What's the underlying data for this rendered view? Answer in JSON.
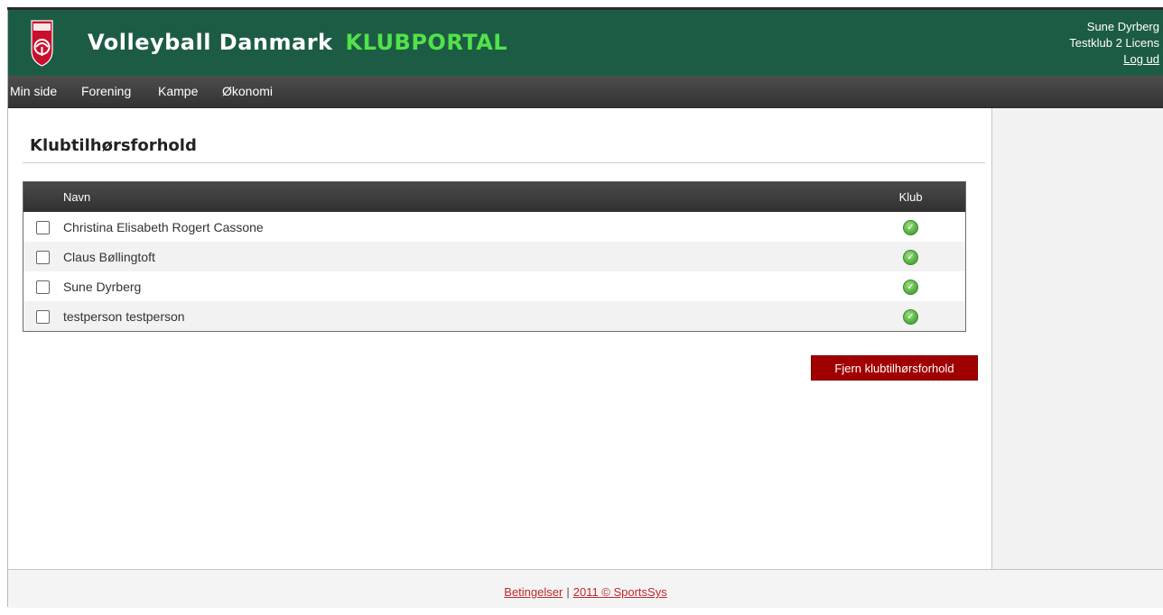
{
  "header": {
    "brand": "Volleyball Danmark",
    "portal": "KLUBPORTAL",
    "logo_text": "VOLLEYBALL DANMARK",
    "user_name": "Sune Dyrberg",
    "user_club": "Testklub 2 Licens",
    "logout": "Log ud"
  },
  "nav": {
    "items": [
      "Min side",
      "Forening",
      "Kampe",
      "Økonomi"
    ]
  },
  "main": {
    "title": "Klubtilhørsforhold",
    "table": {
      "columns": [
        "Navn",
        "Klub"
      ],
      "rows": [
        {
          "name": "Christina Elisabeth Rogert Cassone",
          "klub": "check-icon"
        },
        {
          "name": "Claus Bøllingtoft",
          "klub": "check-icon"
        },
        {
          "name": "Sune Dyrberg",
          "klub": "check-icon"
        },
        {
          "name": "testperson testperson",
          "klub": "check-icon"
        }
      ]
    },
    "remove_button": "Fjern klubtilhørsforhold"
  },
  "footer": {
    "terms": "Betingelser",
    "separator": "|",
    "copyright": "2011 © SportsSys"
  },
  "colors": {
    "header_bg": "#1d5c44",
    "portal_accent": "#52e24a",
    "button_bg": "#a10000",
    "link_red": "#c0282d"
  }
}
